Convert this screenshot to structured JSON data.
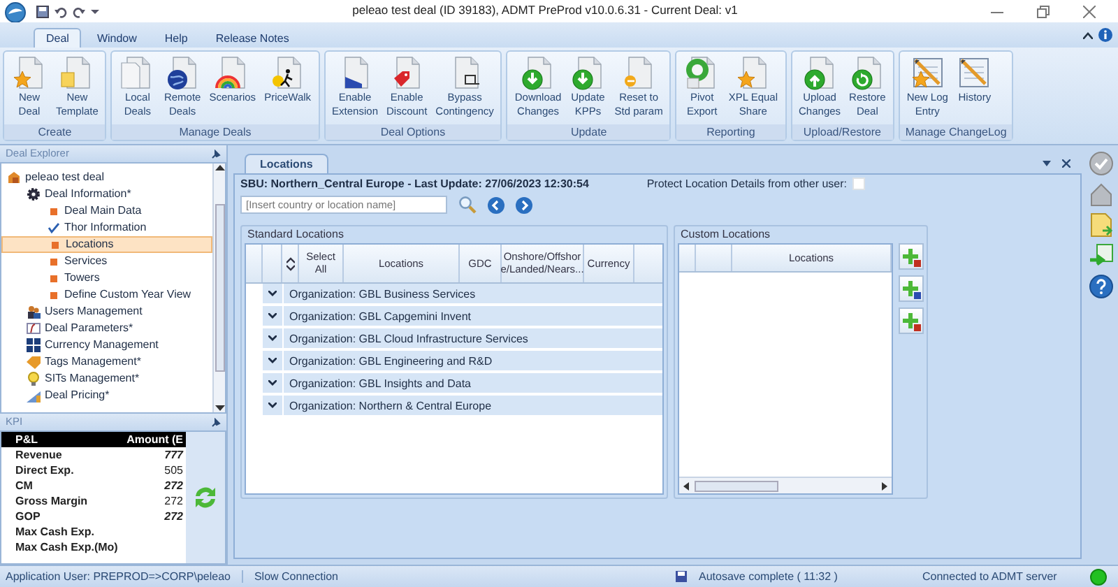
{
  "window": {
    "title": "peleao test deal (ID 39183), ADMT PreProd v10.0.6.31 - Current Deal: v1"
  },
  "ribbon_tabs": [
    {
      "label": "Deal",
      "selected": true
    },
    {
      "label": "Window",
      "selected": false
    },
    {
      "label": "Help",
      "selected": false
    },
    {
      "label": "Release Notes",
      "selected": false
    }
  ],
  "ribbon_groups": [
    {
      "label": "Create",
      "buttons": [
        "New\nDeal",
        "New\nTemplate"
      ]
    },
    {
      "label": "Manage Deals",
      "buttons": [
        "Local\nDeals",
        "Remote\nDeals",
        "Scenarios",
        "PriceWalk"
      ]
    },
    {
      "label": "Deal Options",
      "buttons": [
        "Enable\nExtension",
        "Enable\nDiscount",
        "Bypass\nContingency"
      ]
    },
    {
      "label": "Update",
      "buttons": [
        "Download\nChanges",
        "Update\nKPPs",
        "Reset to\nStd param"
      ]
    },
    {
      "label": "Reporting",
      "buttons": [
        "Pivot\nExport",
        "XPL Equal\nShare"
      ]
    },
    {
      "label": "Upload/Restore",
      "buttons": [
        "Upload\nChanges",
        "Restore\nDeal"
      ]
    },
    {
      "label": "Manage ChangeLog",
      "buttons": [
        "New Log\nEntry",
        "History"
      ]
    }
  ],
  "explorer": {
    "title": "Deal Explorer",
    "tree": [
      {
        "label": "peleao test deal",
        "selected": false,
        "children": [
          {
            "label": "Deal Information*",
            "selected": false,
            "children": [
              {
                "label": "Deal Main Data",
                "kind": "pending",
                "selected": false
              },
              {
                "label": "Thor Information",
                "kind": "done",
                "selected": false
              },
              {
                "label": "Locations",
                "kind": "pending",
                "selected": true
              },
              {
                "label": "Services",
                "kind": "pending",
                "selected": false
              },
              {
                "label": "Towers",
                "kind": "pending",
                "selected": false
              },
              {
                "label": "Define Custom Year View",
                "kind": "pending",
                "selected": false
              }
            ]
          },
          {
            "label": "Users Management",
            "selected": false
          },
          {
            "label": "Deal Parameters*",
            "selected": false
          },
          {
            "label": "Currency Management",
            "selected": false
          },
          {
            "label": "Tags Management*",
            "selected": false
          },
          {
            "label": "SITs Management*",
            "selected": false
          },
          {
            "label": "Deal Pricing*",
            "selected": false
          }
        ]
      }
    ]
  },
  "kpi": {
    "title": "KPI",
    "columns": [
      "P&L",
      "Amount (E"
    ],
    "rows": [
      {
        "label": "Revenue",
        "amount": "777",
        "bold": true
      },
      {
        "label": "Direct Exp.",
        "amount": "505",
        "bold": false
      },
      {
        "label": "CM",
        "amount": "272",
        "bold": true
      },
      {
        "label": "Gross Margin",
        "amount": "272",
        "bold": false
      },
      {
        "label": "GOP",
        "amount": "272",
        "bold": true
      },
      {
        "label": "Max Cash Exp."
      },
      {
        "label": "Max Cash Exp.(Mo)"
      }
    ]
  },
  "locations": {
    "tab": "Locations",
    "sbu": "SBU: Northern_Central Europe - Last Update: 27/06/2023 12:30:54",
    "search": {
      "placeholder": "[Insert country or location name]"
    },
    "protect": {
      "label": "Protect Location Details from other user:",
      "checked": false
    },
    "standard": {
      "title": "Standard Locations",
      "columns": [
        "Select\nAll",
        "Locations",
        "GDC",
        "Onshore/Offshor\ne/Landed/Nears...",
        "Currency"
      ],
      "groups": [
        "Organization: GBL Business Services",
        "Organization: GBL Capgemini Invent",
        "Organization: GBL Cloud Infrastructure Services",
        "Organization: GBL Engineering and R&D",
        "Organization: GBL Insights and Data",
        "Organization: Northern & Central Europe"
      ]
    },
    "custom": {
      "title": "Custom Locations",
      "columns": [
        "Locations"
      ]
    }
  },
  "status_bar": {
    "user": "Application User: PREPROD=>CORP\\peleao",
    "connection": "Slow Connection",
    "autosave": "Autosave complete ( 11:32 )",
    "server": "Connected to ADMT server"
  }
}
